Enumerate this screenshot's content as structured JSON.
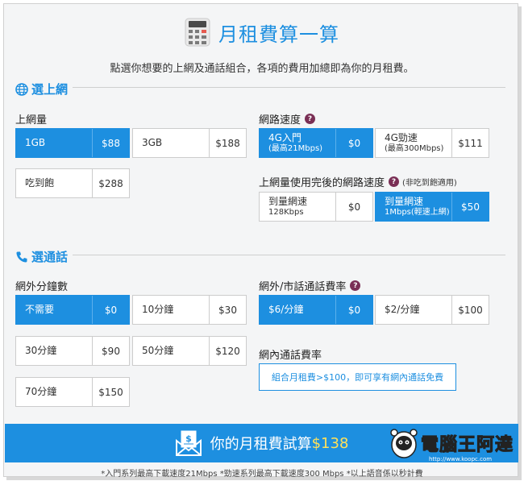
{
  "title": "月租費算一算",
  "subtitle": "點選你想要的上網及通話組合，各項的費用加總即為你的月租費。",
  "data_section": {
    "heading": "選上網",
    "usage_label": "上網量",
    "usage_options": [
      {
        "name": "1GB",
        "price": "$88",
        "selected": true
      },
      {
        "name": "3GB",
        "price": "$188",
        "selected": false
      },
      {
        "name": "吃到飽",
        "price": "$288",
        "selected": false
      }
    ],
    "speed_label": "網路速度",
    "speed_options": [
      {
        "name": "4G入門",
        "sub": "(最高21Mbps)",
        "price": "$0",
        "selected": true
      },
      {
        "name": "4G勁速",
        "sub": "(最高300Mbps)",
        "price": "$111",
        "selected": false
      }
    ],
    "throttle_label": "上網量使用完後的網路速度",
    "throttle_note": "(非吃到飽適用)",
    "throttle_options": [
      {
        "name": "到量網速",
        "sub": "128Kbps",
        "price": "$0",
        "selected": false
      },
      {
        "name": "到量網速",
        "sub": "1Mbps(輕速上網)",
        "price": "$50",
        "selected": true
      }
    ]
  },
  "call_section": {
    "heading": "選通話",
    "minutes_label": "網外分鐘數",
    "minutes_options": [
      {
        "name": "不需要",
        "price": "$0",
        "selected": true
      },
      {
        "name": "10分鐘",
        "price": "$30",
        "selected": false
      },
      {
        "name": "30分鐘",
        "price": "$90",
        "selected": false
      },
      {
        "name": "50分鐘",
        "price": "$120",
        "selected": false
      },
      {
        "name": "70分鐘",
        "price": "$150",
        "selected": false
      }
    ],
    "rate_label": "網外/市話通話費率",
    "rate_options": [
      {
        "name": "$6/分鐘",
        "price": "$0",
        "selected": true
      },
      {
        "name": "$2/分鐘",
        "price": "$100",
        "selected": false
      }
    ],
    "onnet_label": "網內通話費率",
    "onnet_info": "組合月租費>$100，即可享有網內通話免費"
  },
  "total": {
    "label": "你的月租費試算",
    "value": "$138"
  },
  "footnote": "*入門系列最高下載速度21Mbps *勁速系列最高下載速度300 Mbps *以上語音係以秒計費",
  "watermark": {
    "text": "電腦王阿達",
    "url": "http://www.koopc.com"
  },
  "colors": {
    "accent": "#1d8fe0",
    "total_value": "#ffe15a",
    "help_badge": "#7a2f55"
  }
}
